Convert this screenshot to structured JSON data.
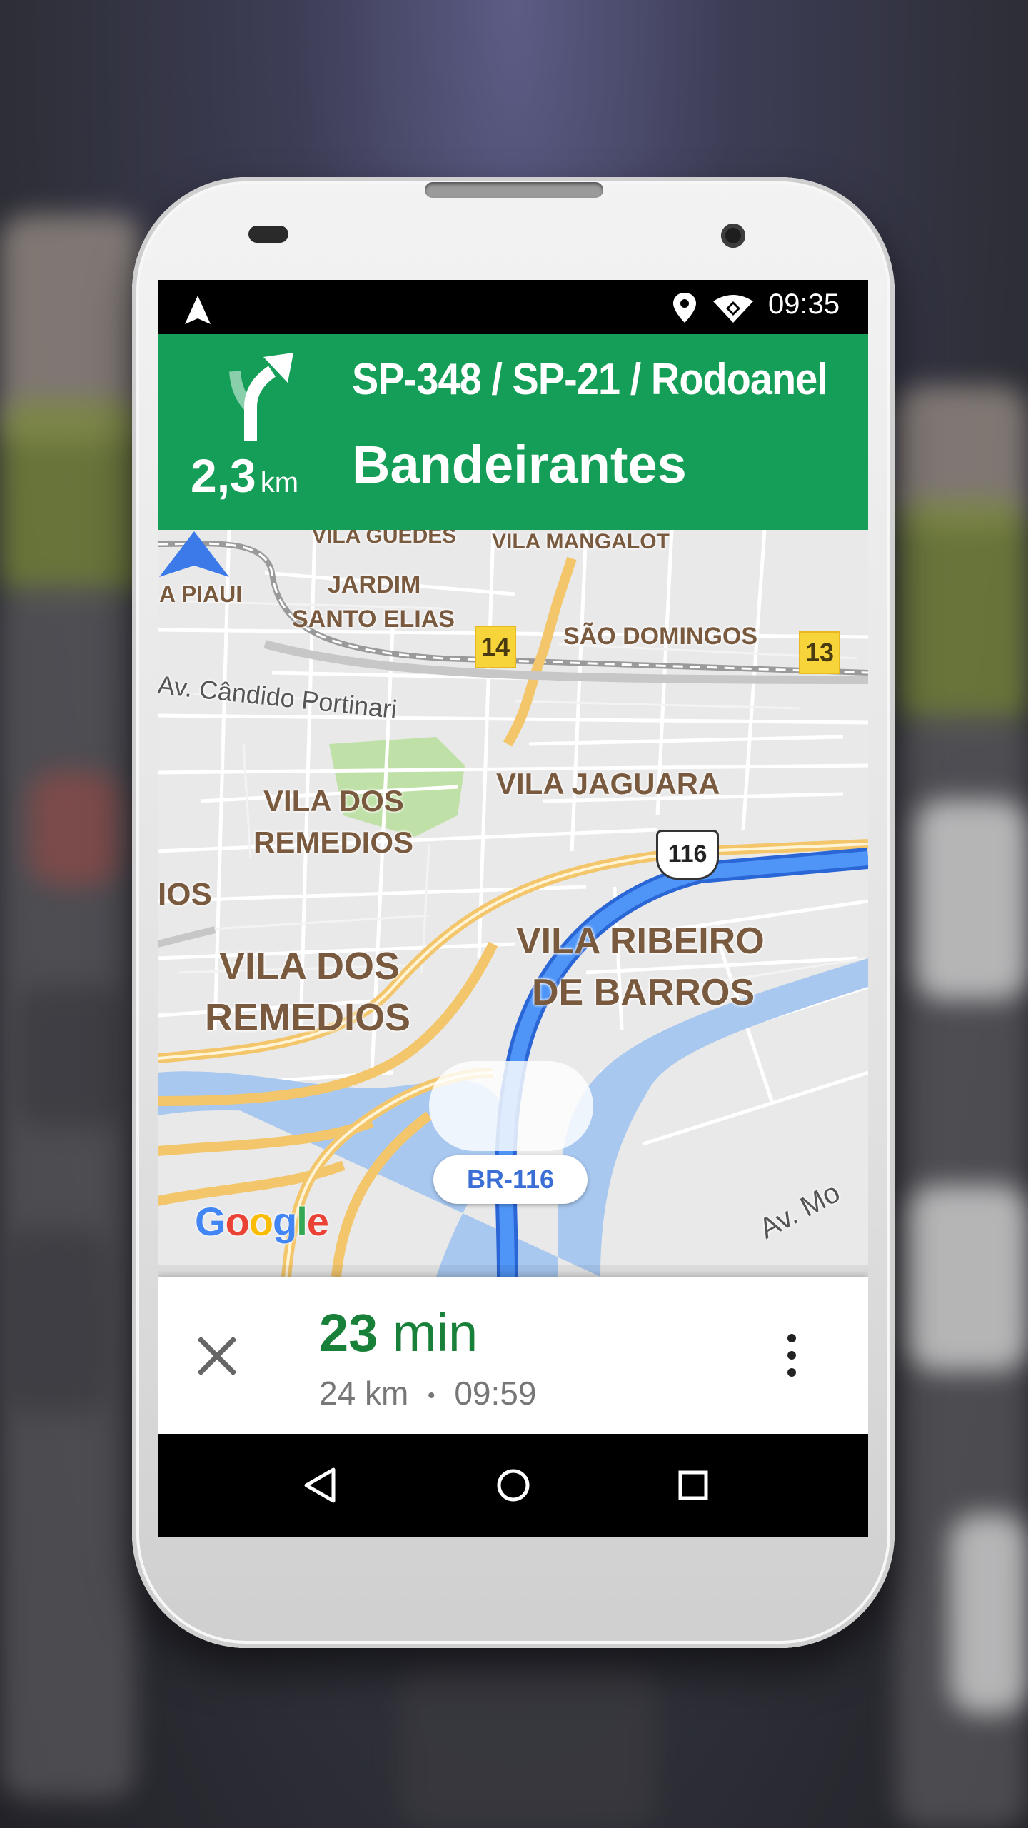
{
  "status_bar": {
    "time": "09:35",
    "icons": [
      "navigation-arrow-icon",
      "location-pin-icon",
      "wifi-icon"
    ]
  },
  "direction": {
    "distance_value": "2,3",
    "distance_unit": "km",
    "road_line1": "SP-348 / SP-21 / Rodoanel",
    "road_line2": "Bandeirantes",
    "turn_icon": "turn-slight-right-icon",
    "banner_color": "#159e57"
  },
  "map": {
    "labels": {
      "vila_guedes": "VILA GUEDES",
      "vila_mangalot": "VILA MANGALOT",
      "piaui": "A PIAUI",
      "jardim": "JARDIM",
      "santo_elias": "SANTO ELIAS",
      "sao_domingos": "SÃO DOMINGOS",
      "candido": "Av. Cândido Portinari",
      "vila_jaguara": "VILA JAGUARA",
      "vila_dos_1": "VILA DOS",
      "remedios_1": "REMEDIOS",
      "ios": "IOS",
      "vila_dos_2": "VILA DOS",
      "remedios_2": "REMEDIOS",
      "vila_ribeiro": "VILA RIBEIRO",
      "de_barros": "DE BARROS",
      "av_mo": "Av. Mo"
    },
    "exit_shields": [
      "14",
      "13"
    ],
    "highway_shield": "116",
    "current_road": "BR-116",
    "logo": "Google",
    "route_color": "#4285f4"
  },
  "trip": {
    "eta_minutes": "23",
    "eta_unit": "min",
    "distance": "24 km",
    "separator": "•",
    "arrival_time": "09:59"
  }
}
